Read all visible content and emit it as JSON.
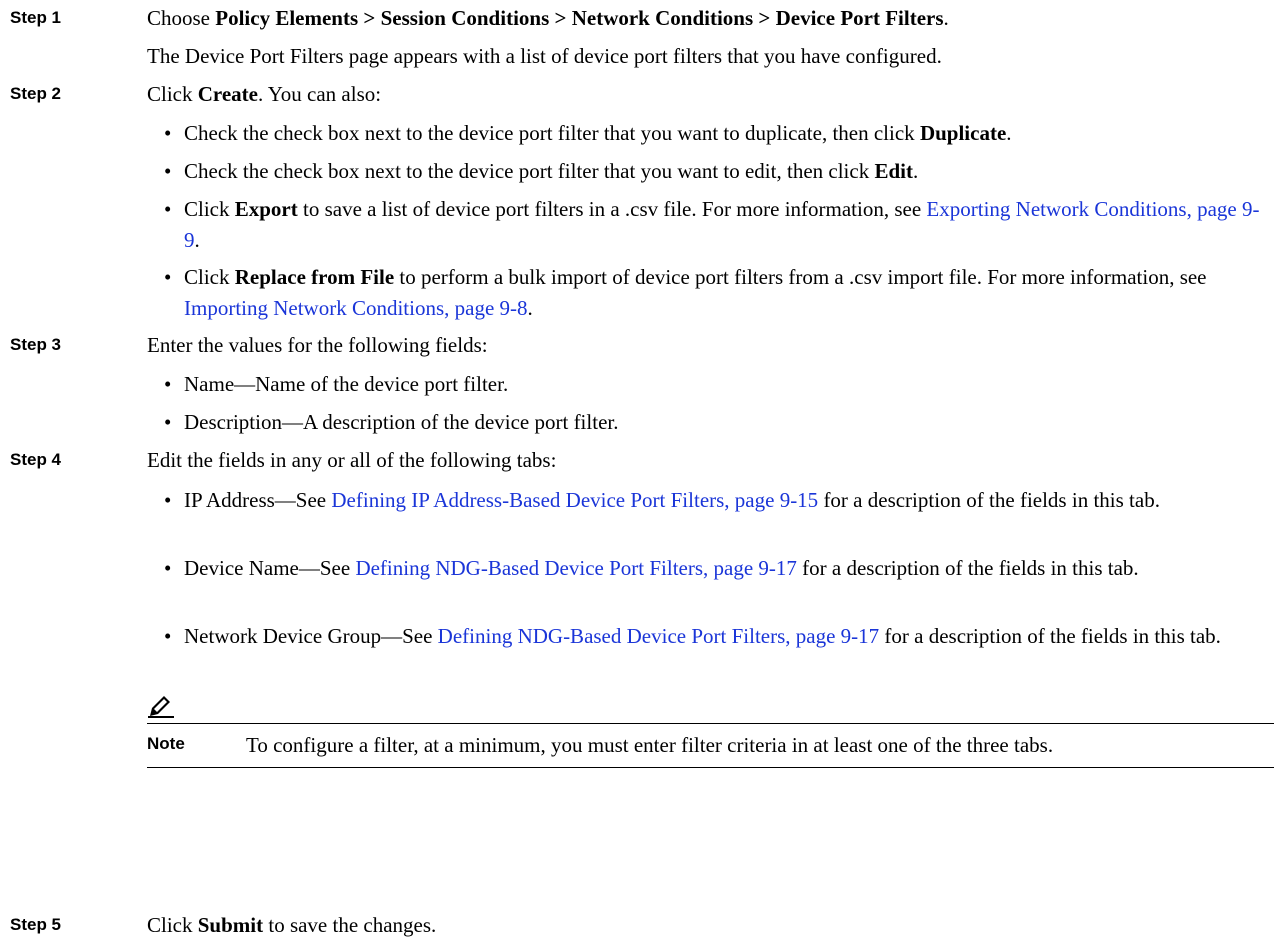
{
  "step1": {
    "label": "Step 1",
    "prefix": "Choose ",
    "path": "Policy Elements > Session Conditions > Network Conditions > Device Port Filters",
    "suffix": ".",
    "info": "The Device Port Filters page appears with a list of device port filters that you have configured."
  },
  "step2": {
    "label": "Step 2",
    "prefix": "Click ",
    "create": "Create",
    "suffix": ". You can also:",
    "b1": {
      "text": "Check the check box next to the device port filter that you want to duplicate, then click ",
      "bold": "Duplicate",
      "end": "."
    },
    "b2": {
      "text": "Check the check box next to the device port filter that you want to edit, then click ",
      "bold": "Edit",
      "end": "."
    },
    "b3": {
      "pre": "Click ",
      "bold": "Export",
      "text": " to save a list of device port filters in a .csv file. For more information, see ",
      "link": "Exporting Network Conditions, page 9-9",
      "end": "."
    },
    "b4": {
      "pre": "Click ",
      "bold": "Replace from File",
      "text": " to perform a bulk import of device port filters from a .csv import file. For more information, see ",
      "link": "Importing Network Conditions, page 9-8",
      "end": "."
    }
  },
  "step3": {
    "label": "Step 3",
    "text": "Enter the values for the following fields:",
    "b1": "Name—Name of the device port filter.",
    "b2": "Description—A description of the device port filter."
  },
  "step4": {
    "label": "Step 4",
    "text": "Edit the fields in any or all of the following tabs:",
    "b1": {
      "pre": "IP Address—See ",
      "link": "Defining IP Address-Based Device Port Filters, page 9-15",
      "post": " for a description of the fields in this tab."
    },
    "b2": {
      "pre": "Device Name—See ",
      "link": "Defining NDG-Based Device Port Filters, page 9-17",
      "post": " for a description of the fields in this tab."
    },
    "b3": {
      "pre": "Network Device Group—See ",
      "link": "Defining NDG-Based Device Port Filters, page 9-17",
      "post": " for a description of the fields in this tab."
    }
  },
  "note": {
    "label": "Note",
    "text": "To configure a filter, at a minimum, you must enter filter criteria in at least one of the three tabs."
  },
  "step5": {
    "label": "Step 5",
    "prefix": "Click ",
    "bold": "Submit",
    "suffix": " to save the changes."
  },
  "bullet_glyph": "•",
  "colors": {
    "link": "#1a35d8",
    "text": "#000000",
    "background": "#ffffff"
  }
}
